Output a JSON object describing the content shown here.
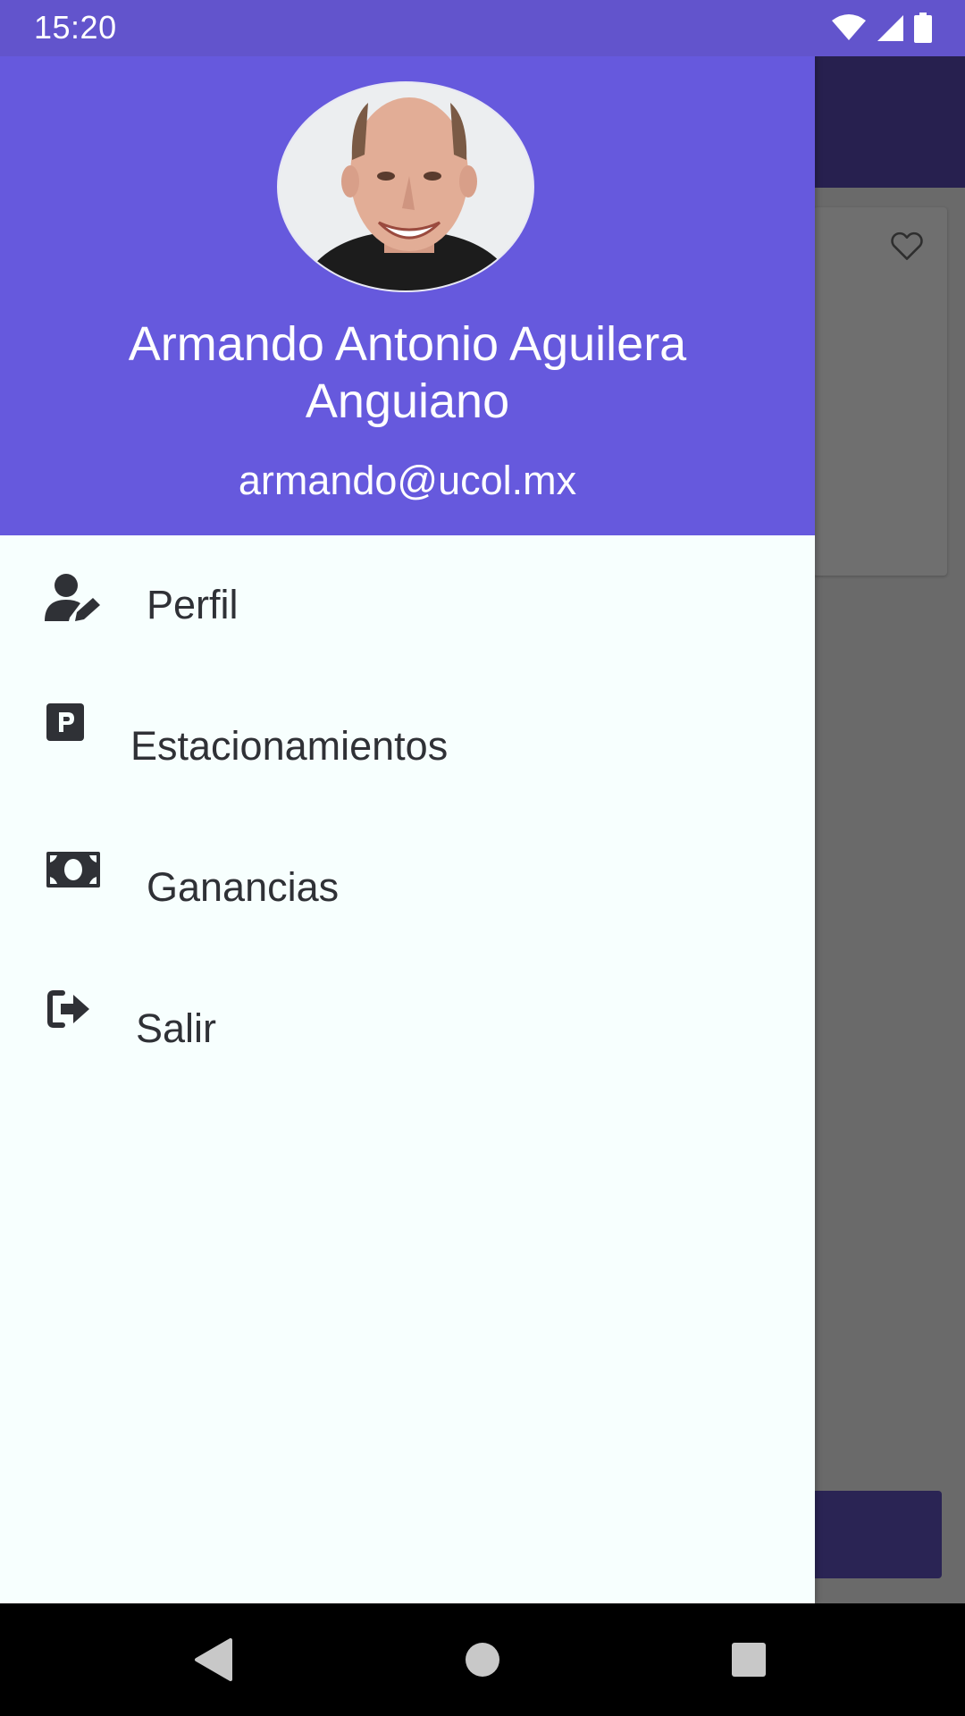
{
  "status_bar": {
    "time": "15:20",
    "icons": [
      "wifi-icon",
      "cellular-signal-icon",
      "battery-icon"
    ]
  },
  "drawer": {
    "header": {
      "avatar": "avatar-photo",
      "name_line1": "Armando Antonio Aguilera",
      "name_line2": "Anguiano",
      "email": "armando@ucol.mx"
    },
    "items": [
      {
        "label": "Perfil",
        "icon": "user-edit-icon"
      },
      {
        "label": "Estacionamientos",
        "icon": "parking-icon"
      },
      {
        "label": "Ganancias",
        "icon": "money-bill-icon"
      },
      {
        "label": "Salir",
        "icon": "sign-out-icon"
      }
    ]
  },
  "background": {
    "card_icon": "heart-outline-icon"
  },
  "nav_bar": {
    "buttons": [
      "back-icon",
      "home-icon",
      "recents-icon"
    ]
  },
  "colors": {
    "status_bar": "#6254cc",
    "header": "#6659dd",
    "drawer_bg": "#f7fffe",
    "menu_text": "#2f3136",
    "scrim": "#6a6a6a",
    "toolbar_dimmed": "#27204f"
  }
}
